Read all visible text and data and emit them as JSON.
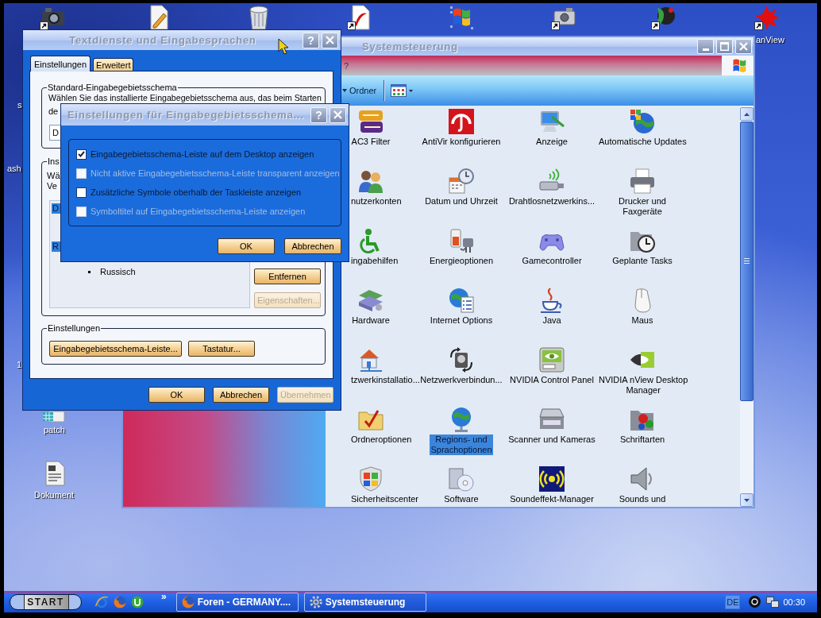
{
  "desktop": {
    "icon_labels": [
      {
        "label": "anView"
      },
      {
        "label": "s"
      },
      {
        "label": "ash"
      },
      {
        "label": "1"
      },
      {
        "label": "patch"
      },
      {
        "label": "Dokument"
      }
    ]
  },
  "control_panel": {
    "title": "Systemsteuerung",
    "menu": [
      {
        "label": "?"
      }
    ],
    "toolbar": {
      "folders_button": "Ordner"
    },
    "items": [
      {
        "label": "AC3 Filter",
        "selected": false
      },
      {
        "label": "AntiVir konfigurieren",
        "selected": false
      },
      {
        "label": "Anzeige",
        "selected": false
      },
      {
        "label": "Automatische Updates",
        "selected": false
      },
      {
        "label": "nutzerkonten",
        "selected": false
      },
      {
        "label": "Datum und Uhrzeit",
        "selected": false
      },
      {
        "label": "Drahtlosnetzwerkins...",
        "selected": false
      },
      {
        "label": "Drucker und\nFaxgeräte",
        "selected": false
      },
      {
        "label": "ingabehilfen",
        "selected": false
      },
      {
        "label": "Energieoptionen",
        "selected": false
      },
      {
        "label": "Gamecontroller",
        "selected": false
      },
      {
        "label": "Geplante Tasks",
        "selected": false
      },
      {
        "label": "Hardware",
        "selected": false
      },
      {
        "label": "Internet Options",
        "selected": false
      },
      {
        "label": "Java",
        "selected": false
      },
      {
        "label": "Maus",
        "selected": false
      },
      {
        "label": "tzwerkinstallatio...",
        "selected": false
      },
      {
        "label": "Netzwerkverbindun...",
        "selected": false
      },
      {
        "label": "NVIDIA Control Panel",
        "selected": false
      },
      {
        "label": "NVIDIA nView Desktop\nManager",
        "selected": false
      },
      {
        "label": "Ordneroptionen",
        "selected": false
      },
      {
        "label": "Regions- und\nSprachoptionen",
        "selected": true
      },
      {
        "label": "Scanner und Kameras",
        "selected": false
      },
      {
        "label": "Schriftarten",
        "selected": false
      },
      {
        "label": "Sicherheitscenter",
        "selected": false
      },
      {
        "label": "Software",
        "selected": false
      },
      {
        "label": "Soundeffekt-Manager",
        "selected": false
      },
      {
        "label": "Sounds und",
        "selected": false
      }
    ]
  },
  "dialog": {
    "title": "Textdienste und Eingabesprachen",
    "help": "?",
    "tabs": [
      {
        "label": "Einstellungen",
        "selected": true
      },
      {
        "label": "Erweitert",
        "selected": false
      }
    ],
    "default_group": {
      "label": "Standard-Eingabegebietsschema",
      "lines": [
        "Wählen Sie das installierte Eingabegebietsschema aus, das beim Starten",
        "de"
      ],
      "dropdown_value": "D"
    },
    "installed_group": {
      "label": "Ins",
      "lines": [
        "Wä",
        "Ve"
      ],
      "list": [
        {
          "kind": "language",
          "text": "D"
        },
        {
          "kind": "language",
          "text": "R"
        },
        {
          "kind": "keyboard",
          "text": "Russisch"
        }
      ],
      "buttons": [
        {
          "label": "Entfernen",
          "disabled": false
        },
        {
          "label": "Eigenschaften...",
          "disabled": true
        }
      ]
    },
    "settings_group": {
      "label": "Einstellungen",
      "buttons": [
        {
          "label": "Eingabegebietsschema-Leiste...",
          "disabled": false
        },
        {
          "label": "Tastatur...",
          "disabled": false
        }
      ]
    },
    "buttons": [
      {
        "label": "OK",
        "disabled": false
      },
      {
        "label": "Abbrechen",
        "disabled": false
      },
      {
        "label": "Übernehmen",
        "disabled": true
      }
    ]
  },
  "language_bar_dialog": {
    "title": "Einstellungen für Eingabegebietsschema...",
    "help": "?",
    "options": [
      {
        "label": "Eingabegebietsschema-Leiste auf dem Desktop anzeigen",
        "checked": true,
        "disabled": false
      },
      {
        "label": "Nicht aktive Eingabegebietsschema-Leiste transparent anzeigen",
        "checked": false,
        "disabled": true
      },
      {
        "label": "Zusätzliche Symbole oberhalb der Taskleiste anzeigen",
        "checked": false,
        "disabled": false
      },
      {
        "label": "Symboltitel auf Eingabegebietsschema-Leiste anzeigen",
        "checked": false,
        "disabled": true
      }
    ],
    "buttons": [
      {
        "label": "OK",
        "disabled": false
      },
      {
        "label": "Abbrechen",
        "disabled": false
      }
    ]
  },
  "taskbar": {
    "start": "START",
    "more": "»",
    "tasks": [
      {
        "label": "Foren - GERMANY...."
      },
      {
        "label": "Systemsteuerung"
      }
    ],
    "tray": {
      "language": "DE",
      "clock": "00:30"
    }
  }
}
